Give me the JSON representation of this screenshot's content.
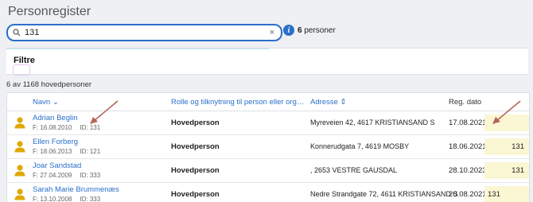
{
  "app": {
    "title": "Personregister"
  },
  "search": {
    "value": "131",
    "clear_glyph": "×"
  },
  "result_count": {
    "number": "6",
    "suffix": "personer"
  },
  "filters": {
    "label": "Filtre"
  },
  "summary": "6 av 1168 hovedpersoner",
  "table": {
    "headers": {
      "name": "Navn ⌄",
      "role": "Rolle og tilknytning til person eller organisasjon",
      "address": "Adresse ⇕",
      "date": "Reg. dato"
    },
    "rows": [
      {
        "name": "Adrian Beglin",
        "birth": "F: 16.08.2010",
        "id": "ID: 131",
        "role": "Hovedperson",
        "address": "Myreveien 42, 4617 KRISTIANSAND S",
        "date": "17.08.2021",
        "extra": ""
      },
      {
        "name": "Ellen Forberg",
        "birth": "F: 18.06.2013",
        "id": "ID: 121",
        "role": "Hovedperson",
        "address": "Konnerudgata 7, 4619 MOSBY",
        "date": "18.06.2021",
        "extra": "131"
      },
      {
        "name": "Joar Sandstad",
        "birth": "F: 27.04.2009",
        "id": "ID: 333",
        "role": "Hovedperson",
        "address": ", 2653 VESTRE GAUSDAL",
        "date": "28.10.2023",
        "extra": "131"
      },
      {
        "name": "Sarah Marie Brummenæs",
        "birth": "F: 13.10.2008",
        "id": "ID: 333",
        "role": "Hovedperson",
        "address": "Nedre Strandgate 72, 4611 KRISTIANSAND S",
        "date": "20.08.2021",
        "extra": "131"
      }
    ]
  },
  "icons": {
    "search": "search-icon",
    "info": "info-icon",
    "avatar": "person-icon",
    "annotation": "arrow-annotation"
  },
  "colors": {
    "accent": "#2a6fc9",
    "avatar": "#e0a800",
    "highlight": "#fbf6d3",
    "arrow": "#b5655a"
  }
}
